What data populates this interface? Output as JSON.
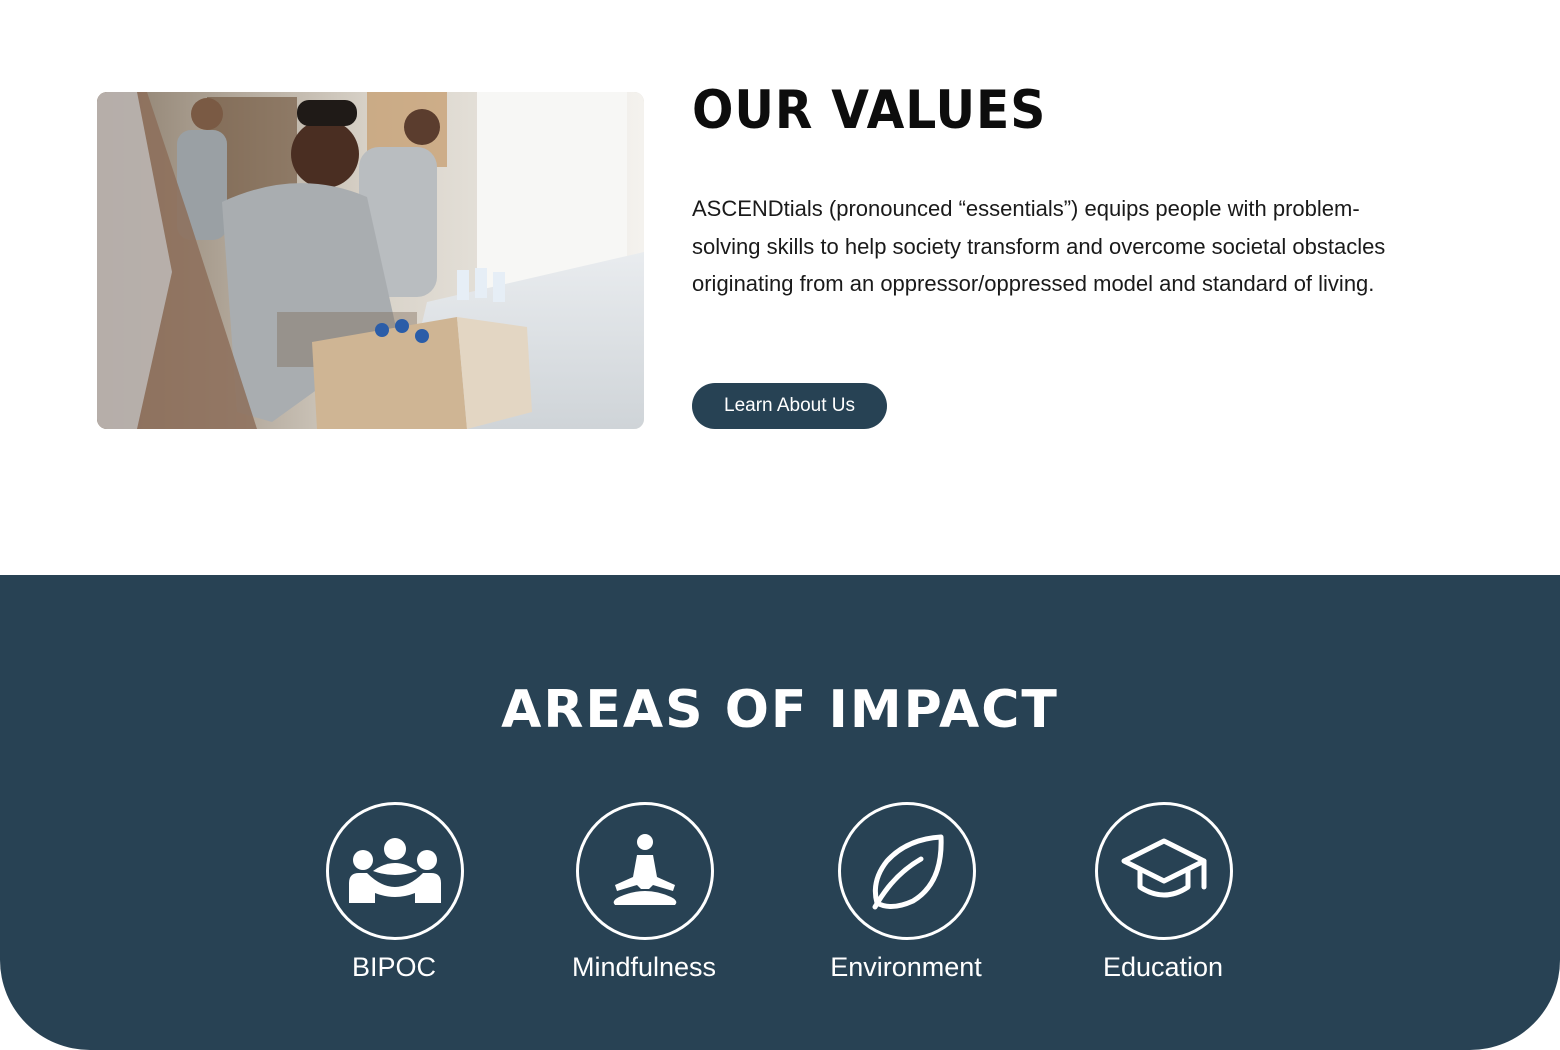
{
  "values": {
    "title": "OUR VALUES",
    "body": "ASCENDtials (pronounced “essentials”) equips people with problem-solving skills to help society transform and overcome societal obstacles originating from an oppressor/oppressed model and standard of living.",
    "button_label": "Learn About Us"
  },
  "impact": {
    "title": "AREAS OF IMPACT",
    "items": [
      {
        "label": "BIPOC",
        "icon": "people-group-icon"
      },
      {
        "label": "Mindfulness",
        "icon": "meditation-icon"
      },
      {
        "label": "Environment",
        "icon": "leaf-icon"
      },
      {
        "label": "Education",
        "icon": "graduation-cap-icon"
      }
    ]
  },
  "colors": {
    "accent": "#274254",
    "impact_background": "#284254",
    "text_dark": "#0d0d0d",
    "text_light": "#ffffff"
  }
}
